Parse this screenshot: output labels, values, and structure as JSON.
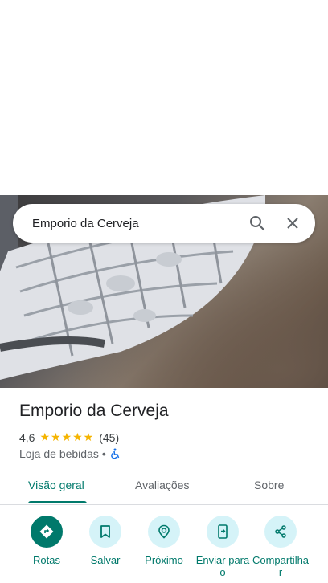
{
  "search": {
    "query": "Emporio da Cerveja"
  },
  "place": {
    "name": "Emporio da Cerveja",
    "rating": "4,6",
    "stars": "★★★★★",
    "review_count": "(45)",
    "category": "Loja de bebidas",
    "separator": "•"
  },
  "tabs": [
    {
      "label": "Visão geral"
    },
    {
      "label": "Avaliações"
    },
    {
      "label": "Sobre"
    }
  ],
  "actions": [
    {
      "label": "Rotas"
    },
    {
      "label": "Salvar"
    },
    {
      "label": "Próximo"
    },
    {
      "label": "Enviar para o"
    },
    {
      "label": "Compartilha r"
    }
  ],
  "colors": {
    "accent": "#00796b",
    "chip": "#d5f3f8",
    "star": "#f5b400"
  }
}
